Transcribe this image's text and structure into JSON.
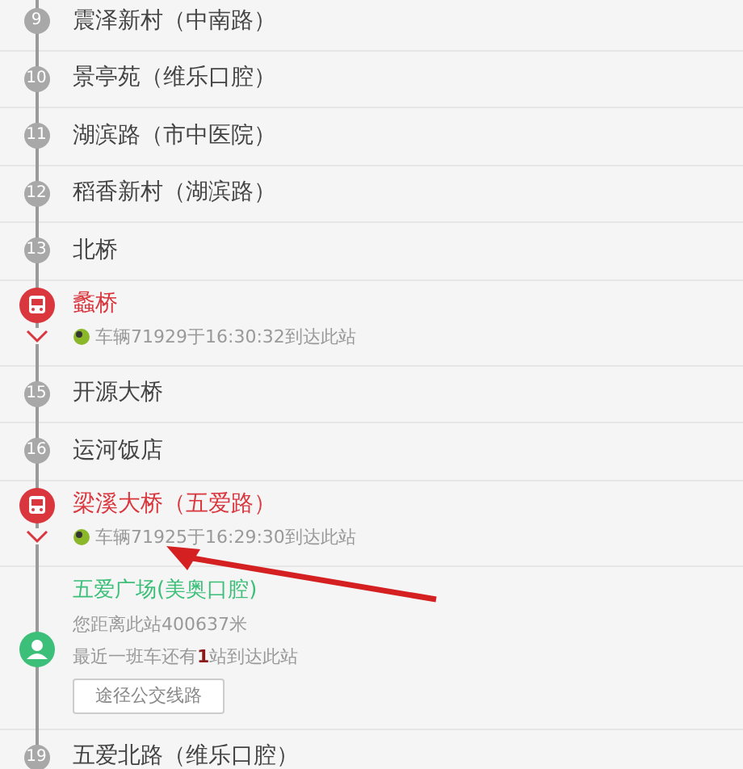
{
  "stations": [
    {
      "kind": "stop",
      "number": "9",
      "name": "震泽新村（中南路）"
    },
    {
      "kind": "stop",
      "number": "10",
      "name": "景亭苑（维乐口腔）"
    },
    {
      "kind": "stop",
      "number": "11",
      "name": "湖滨路（市中医院）"
    },
    {
      "kind": "stop",
      "number": "12",
      "name": "稻香新村（湖滨路）"
    },
    {
      "kind": "stop",
      "number": "13",
      "name": "北桥"
    },
    {
      "kind": "bus",
      "name": "蠡桥",
      "vehicle": "车辆71929于16:30:32到达此站"
    },
    {
      "kind": "stop",
      "number": "15",
      "name": "开源大桥"
    },
    {
      "kind": "stop",
      "number": "16",
      "name": "运河饭店"
    },
    {
      "kind": "bus",
      "name": "梁溪大桥（五爱路）",
      "vehicle": "车辆71925于16:29:30到达此站"
    },
    {
      "kind": "current",
      "name": "五爱广场(美奥口腔)",
      "distance": "您距离此站400637米",
      "next_bus": "最近一班车还有**1**站到达此站",
      "button": "途径公交线路"
    },
    {
      "kind": "stop",
      "number": "19",
      "name": "五爱北路（维乐口腔）"
    }
  ]
}
